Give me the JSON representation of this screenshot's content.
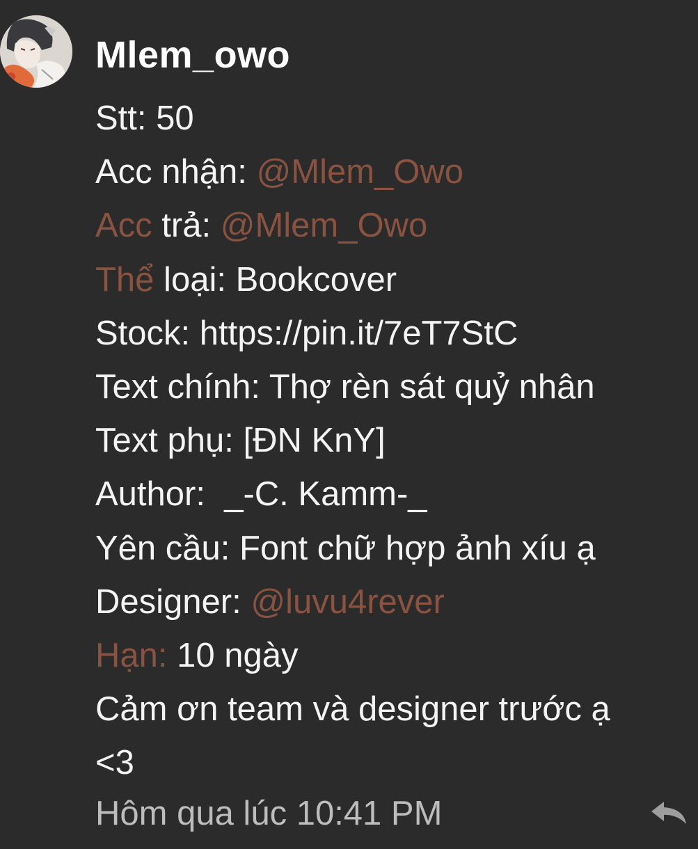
{
  "comment": {
    "username": "Mlem_owo",
    "lines": {
      "stt": {
        "label": "Stt:",
        "value": " 50"
      },
      "acc_nhan": {
        "label": "Acc nhận: ",
        "mention": "@Mlem_Owo"
      },
      "acc_tra": {
        "label_hl": "Acc",
        "label": " trả: ",
        "mention": "@Mlem_Owo"
      },
      "the_loai": {
        "label_hl": "Thể",
        "label": " loại: ",
        "value": "Bookcover"
      },
      "stock": {
        "label": "Stock: ",
        "value": "https://pin.it/7eT7StC"
      },
      "text_chinh": {
        "label": "Text chính: ",
        "value": "Thợ rèn sát quỷ nhân"
      },
      "text_phu": {
        "label": "Text phụ: ",
        "value": "[ĐN KnY]"
      },
      "author": {
        "label": "Author: ",
        "value": " _-C. Kamm-_"
      },
      "yeu_cau": {
        "label": "Yên cầu: ",
        "value": "Font chữ hợp ảnh xíu ạ"
      },
      "designer": {
        "label": "Designer: ",
        "mention": "@luvu4rever"
      },
      "han": {
        "label_hl": "Hạn:",
        "value": " 10 ngày"
      },
      "thanks_1": "Cảm ơn team và designer trước ạ",
      "thanks_2": "<3"
    },
    "timestamp": "Hôm qua lúc 10:41 PM",
    "reply_icon": "reply-icon",
    "colors": {
      "background": "#2b2b2b",
      "text": "#f4f4f4",
      "mention": "#8a5240",
      "timestamp": "#bdbdbd"
    }
  }
}
